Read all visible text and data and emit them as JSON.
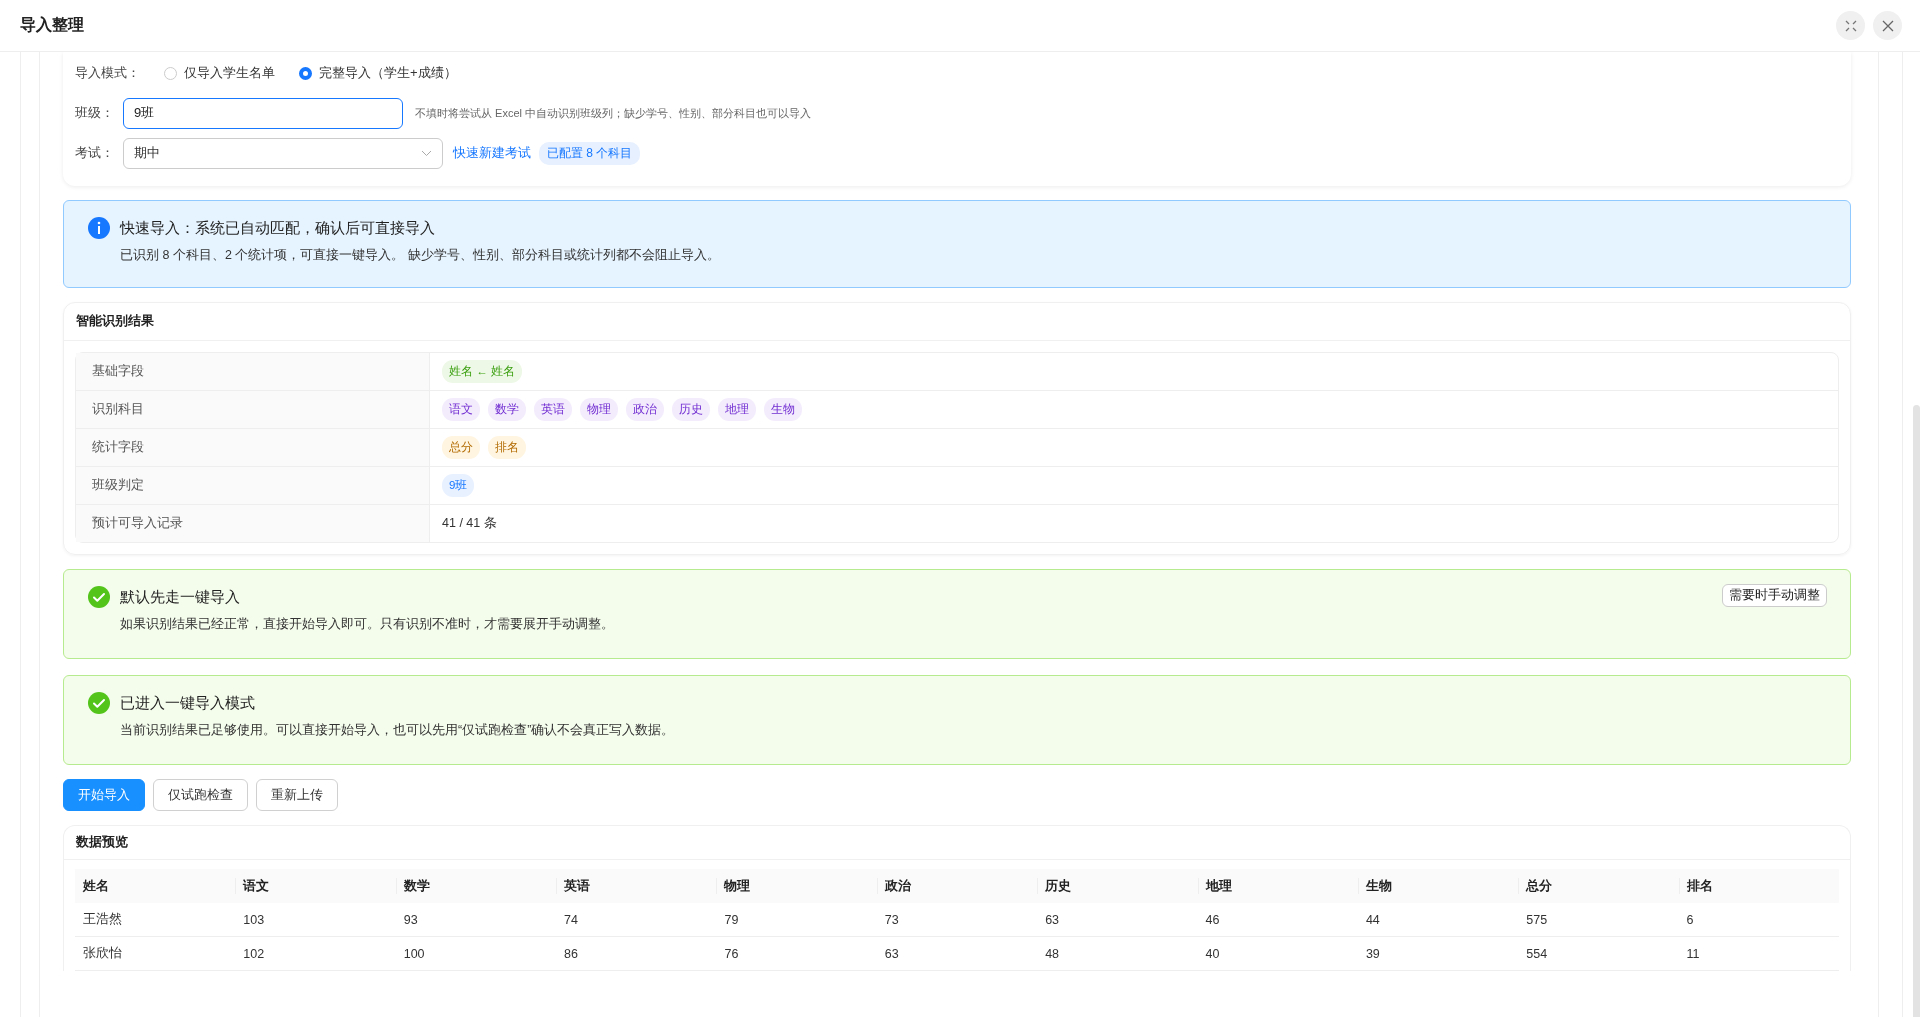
{
  "dialog": {
    "title": "导入整理"
  },
  "form": {
    "mode": {
      "label": "导入模式：",
      "options": [
        {
          "label": "仅导入学生名单",
          "selected": false
        },
        {
          "label": "完整导入（学生+成绩）",
          "selected": true
        }
      ]
    },
    "class_field": {
      "label": "班级：",
      "value": "9班",
      "hint": "不填时将尝试从 Excel 中自动识别班级列；缺少学号、性别、部分科目也可以导入"
    },
    "exam_field": {
      "label": "考试：",
      "value": "期中",
      "link": "快速新建考试",
      "badge": "已配置 8 个科目"
    }
  },
  "info_alert": {
    "title": "快速导入：系统已自动匹配，确认后可直接导入",
    "text": "已识别 8 个科目、2 个统计项，可直接一键导入。 缺少学号、性别、部分科目或统计列都不会阻止导入。"
  },
  "recognition": {
    "title": "智能识别结果",
    "rows": [
      {
        "label": "基础字段",
        "kind": "basic",
        "tags": [
          "姓名 ← 姓名"
        ]
      },
      {
        "label": "识别科目",
        "kind": "subject",
        "tags": [
          "语文",
          "数学",
          "英语",
          "物理",
          "政治",
          "历史",
          "地理",
          "生物"
        ]
      },
      {
        "label": "统计字段",
        "kind": "stat",
        "tags": [
          "总分",
          "排名"
        ]
      },
      {
        "label": "班级判定",
        "kind": "class",
        "tags": [
          "9班"
        ]
      },
      {
        "label": "预计可导入记录",
        "kind": "count",
        "text": "41 / 41 条"
      }
    ]
  },
  "success_alerts": [
    {
      "title": "默认先走一键导入",
      "text": "如果识别结果已经正常，直接开始导入即可。只有识别不准时，才需要展开手动调整。",
      "button": "需要时手动调整"
    },
    {
      "title": "已进入一键导入模式",
      "text": "当前识别结果已足够使用。可以直接开始导入，也可以先用“仅试跑检查”确认不会真正写入数据。"
    }
  ],
  "actions": [
    {
      "label": "开始导入",
      "kind": "primary"
    },
    {
      "label": "仅试跑检查",
      "kind": "default"
    },
    {
      "label": "重新上传",
      "kind": "default"
    }
  ],
  "preview": {
    "title": "数据预览",
    "columns": [
      "姓名",
      "语文",
      "数学",
      "英语",
      "物理",
      "政治",
      "历史",
      "地理",
      "生物",
      "总分",
      "排名"
    ],
    "rows": [
      [
        "王浩然",
        "103",
        "93",
        "74",
        "79",
        "73",
        "63",
        "46",
        "44",
        "575",
        "6"
      ],
      [
        "张欣怡",
        "102",
        "100",
        "86",
        "76",
        "63",
        "48",
        "40",
        "39",
        "554",
        "11"
      ]
    ]
  }
}
